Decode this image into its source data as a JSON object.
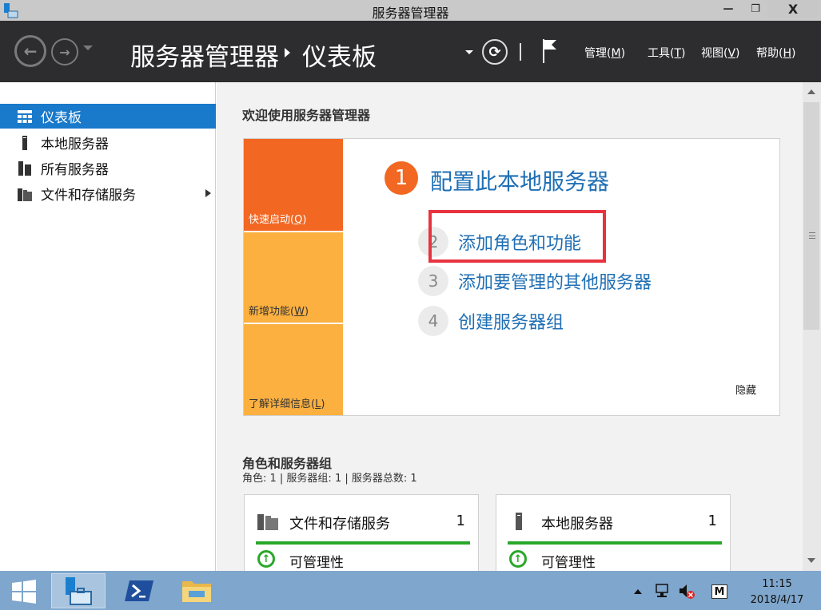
{
  "window": {
    "title": "服务器管理器",
    "controls": {
      "minimize": "—",
      "maximize": "❐",
      "close": "X"
    }
  },
  "header": {
    "breadcrumb": [
      "服务器管理器",
      "仪表板"
    ],
    "menus": [
      {
        "label": "管理",
        "key": "M"
      },
      {
        "label": "工具",
        "key": "T"
      },
      {
        "label": "视图",
        "key": "V"
      },
      {
        "label": "帮助",
        "key": "H"
      }
    ]
  },
  "sidebar": {
    "items": [
      {
        "label": "仪表板",
        "icon": "dashboard-icon",
        "active": true
      },
      {
        "label": "本地服务器",
        "icon": "server-icon",
        "active": false
      },
      {
        "label": "所有服务器",
        "icon": "servers-icon",
        "active": false
      },
      {
        "label": "文件和存储服务",
        "icon": "file-storage-icon",
        "active": false,
        "expandable": true
      }
    ]
  },
  "main": {
    "welcome_title": "欢迎使用服务器管理器",
    "tiles": [
      {
        "label": "快速启动",
        "key": "Q"
      },
      {
        "label": "新增功能",
        "key": "W"
      },
      {
        "label": "了解详细信息",
        "key": "L"
      }
    ],
    "steps": [
      {
        "num": "1",
        "label": "配置此本地服务器"
      },
      {
        "num": "2",
        "label": "添加角色和功能"
      },
      {
        "num": "3",
        "label": "添加要管理的其他服务器"
      },
      {
        "num": "4",
        "label": "创建服务器组"
      }
    ],
    "hide_label": "隐藏",
    "roles_title": "角色和服务器组",
    "roles_subtitle": "角色: 1 | 服务器组: 1 | 服务器总数: 1",
    "role_cards": [
      {
        "title": "文件和存储服务",
        "count": "1",
        "status": "可管理性"
      },
      {
        "title": "本地服务器",
        "count": "1",
        "status": "可管理性"
      }
    ]
  },
  "taskbar": {
    "apps": [
      "server-manager-app",
      "powershell-app",
      "file-explorer-app"
    ],
    "tray_m": "M",
    "time": "11:15",
    "date": "2018/4/17"
  },
  "colors": {
    "accent": "#1979ca",
    "header_bg": "#2d2d30",
    "tile_orange": "#f26722",
    "tile_yellow": "#fbb040",
    "link_blue": "#1f6fb5",
    "highlight_red": "#e8333f",
    "status_green": "#2aa72a",
    "taskbar_bg": "#7fa6cc"
  }
}
